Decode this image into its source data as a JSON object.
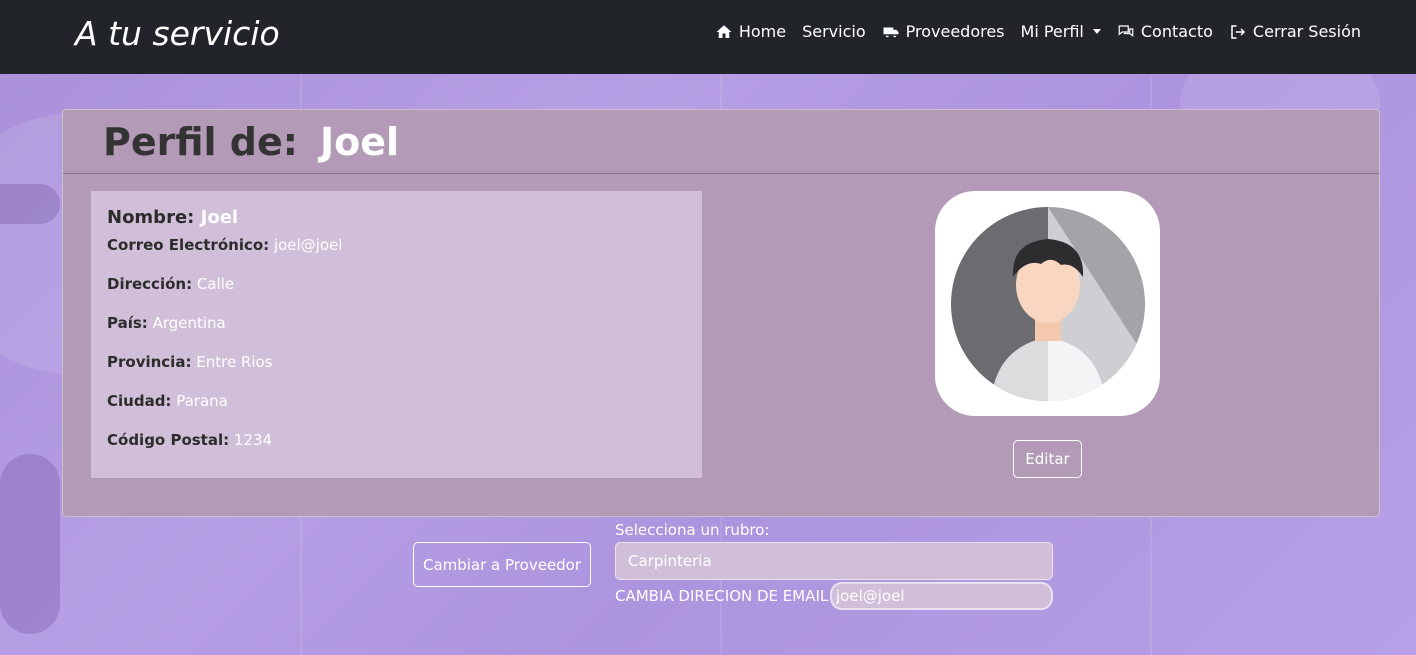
{
  "brand": "A tu servicio",
  "nav": {
    "home": "Home",
    "servicio": "Servicio",
    "proveedores": "Proveedores",
    "mi_perfil": "Mi Perfil",
    "contacto": "Contacto",
    "cerrar": "Cerrar Sesión"
  },
  "profile": {
    "title": "Perfil de:",
    "name": "Joel",
    "fields": {
      "nombre_label": "Nombre:",
      "nombre": "Joel",
      "correo_label": "Correo Electrónico:",
      "correo": "joel@joel",
      "direccion_label": "Dirección:",
      "direccion": "Calle",
      "pais_label": "País:",
      "pais": "Argentina",
      "provincia_label": "Provincia:",
      "provincia": "Entre Rios",
      "ciudad_label": "Ciudad:",
      "ciudad": "Parana",
      "cp_label": "Código Postal:",
      "cp": "1234"
    },
    "edit_label": "Editar"
  },
  "actions": {
    "switch_label": "Cambiar a Proveedor",
    "rubro_label": "Selecciona un rubro:",
    "rubro_value": "Carpinteria",
    "email_label": "CAMBIA DIRECION DE EMAIL",
    "email_value": "joel@joel"
  }
}
